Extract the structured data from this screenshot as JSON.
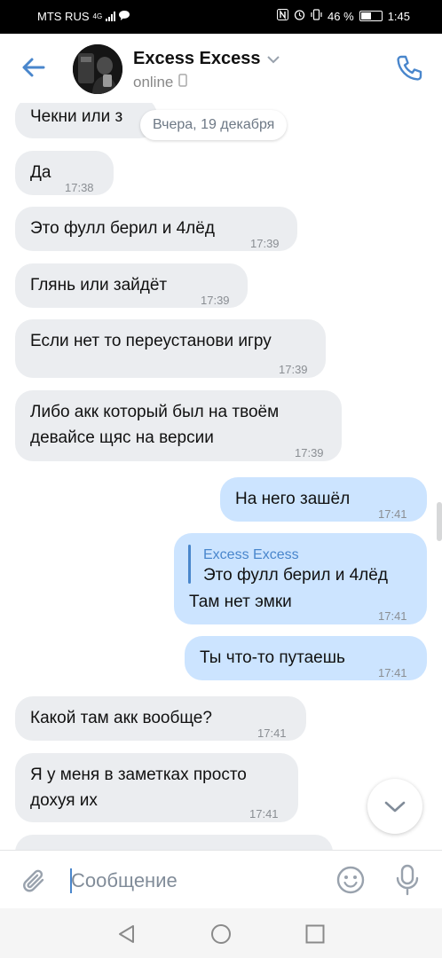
{
  "status_bar": {
    "carrier": "MTS RUS",
    "network": "4G",
    "battery": "46 %",
    "time": "1:45"
  },
  "header": {
    "contact_name": "Excess Excess",
    "status": "online",
    "back_icon": "arrow-left-icon",
    "call_icon": "phone-icon",
    "accent_color": "#4986cc"
  },
  "date_separator": "Вчера, 19 декабря",
  "messages": [
    {
      "direction": "in",
      "text": "Чекни или з"
    },
    {
      "direction": "in",
      "text": "Да",
      "time": "17:38"
    },
    {
      "direction": "in",
      "text": "Это фулл берил и 4лёд",
      "time": "17:39"
    },
    {
      "direction": "in",
      "text": "Глянь или зайдёт",
      "time": "17:39"
    },
    {
      "direction": "in",
      "text": "Если нет то переустанови игру",
      "time": "17:39"
    },
    {
      "direction": "in",
      "lines": [
        "Либо акк который был на твоём",
        "девайсе щяс на версии"
      ],
      "time": "17:39"
    },
    {
      "direction": "out",
      "text": "На него зашёл",
      "time": "17:41"
    },
    {
      "direction": "out",
      "reply_to": {
        "author": "Excess Excess",
        "text": "Это фулл берил и 4лёд"
      },
      "text": "Там нет эмки",
      "time": "17:41"
    },
    {
      "direction": "out",
      "text": "Ты что-то путаешь",
      "time": "17:41"
    },
    {
      "direction": "in",
      "text": "Какой там акк вообще?",
      "time": "17:41"
    },
    {
      "direction": "in",
      "lines": [
        "Я у меня в заметках просто",
        "дохуя их"
      ],
      "time": "17:41"
    }
  ],
  "composer": {
    "placeholder": "Сообщение",
    "attach_icon": "paperclip-icon",
    "emoji_icon": "smiley-icon",
    "mic_icon": "microphone-icon"
  },
  "colors": {
    "incoming_bubble": "#ebedf0",
    "outgoing_bubble": "#cce4ff"
  }
}
